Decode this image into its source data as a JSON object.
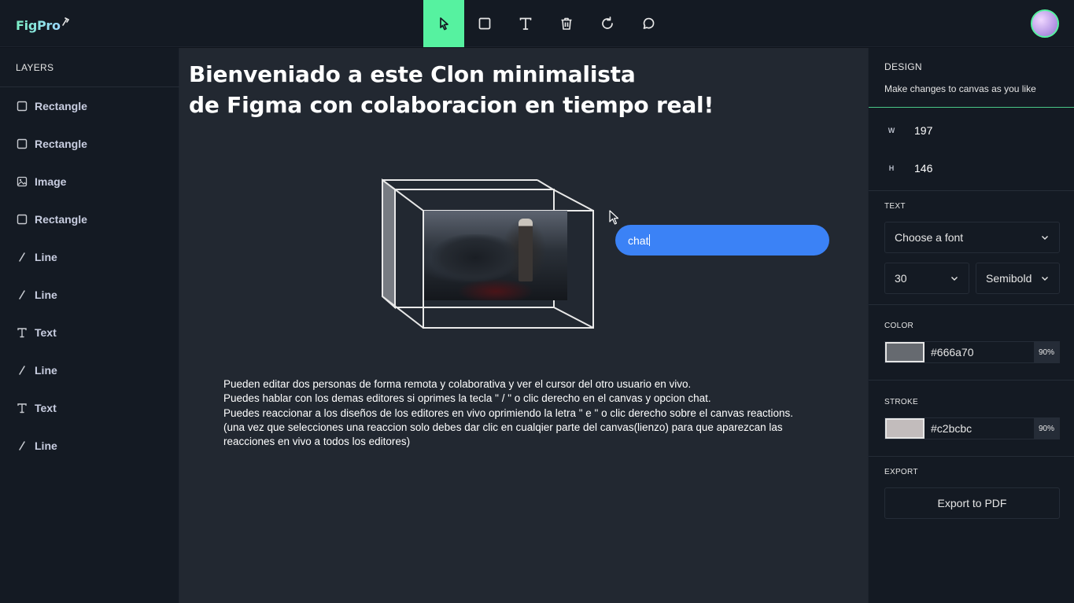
{
  "app": {
    "logo_text": "FigPro",
    "logo_icon": "pen-nib-icon"
  },
  "toolbar": {
    "tools": [
      {
        "name": "select",
        "icon": "cursor-arrow-icon",
        "active": true
      },
      {
        "name": "rectangle",
        "icon": "square-icon",
        "active": false
      },
      {
        "name": "text",
        "icon": "text-t-icon",
        "active": false
      },
      {
        "name": "delete",
        "icon": "trash-icon",
        "active": false
      },
      {
        "name": "reset",
        "icon": "rotate-icon",
        "active": false
      },
      {
        "name": "comment",
        "icon": "chat-bubble-icon",
        "active": false
      }
    ],
    "active_color": "#56f2a0"
  },
  "layers_panel": {
    "title": "LAYERS",
    "items": [
      {
        "label": "Rectangle",
        "icon": "square-icon"
      },
      {
        "label": "Rectangle",
        "icon": "square-icon"
      },
      {
        "label": "Image",
        "icon": "image-icon"
      },
      {
        "label": "Rectangle",
        "icon": "square-icon"
      },
      {
        "label": "Line",
        "icon": "line-icon"
      },
      {
        "label": "Line",
        "icon": "line-icon"
      },
      {
        "label": "Text",
        "icon": "text-t-icon"
      },
      {
        "label": "Line",
        "icon": "line-icon"
      },
      {
        "label": "Text",
        "icon": "text-t-icon"
      },
      {
        "label": "Line",
        "icon": "line-icon"
      }
    ]
  },
  "canvas": {
    "headline_line1": "Bienveniado a este Clon minimalista",
    "headline_line2": "de Figma con colaboracion en tiempo real!",
    "chat_value": "chat",
    "info_lines": [
      "Pueden editar dos personas de forma remota y colaborativa y ver el cursor del otro usuario en vivo.",
      "Puedes hablar con los demas editores si oprimes la tecla \" / \" o clic derecho en el canvas y opcion chat.",
      "Puedes reaccionar a los diseños de los editores en vivo oprimiendo la letra \" e \" o clic derecho sobre el canvas reactions.",
      "(una vez que selecciones una reaccion solo debes dar clic en cualqier parte del canvas(lienzo) para que aparezcan las",
      "reacciones en vivo a todos los editores)"
    ]
  },
  "design_panel": {
    "title": "DESIGN",
    "subtitle": "Make changes to canvas as you like",
    "width_label": "W",
    "width_value": "197",
    "height_label": "H",
    "height_value": "146",
    "text_section": {
      "title": "TEXT",
      "font_select": "Choose a font",
      "size_select": "30",
      "weight_select": "Semibold"
    },
    "color_section": {
      "title": "COLOR",
      "hex": "#666a70",
      "opacity": "90%",
      "swatch": "#666a70"
    },
    "stroke_section": {
      "title": "STROKE",
      "hex": "#c2bcbc",
      "opacity": "90%",
      "swatch": "#c2bcbc"
    },
    "export_section": {
      "title": "EXPORT",
      "button": "Export to PDF"
    }
  }
}
